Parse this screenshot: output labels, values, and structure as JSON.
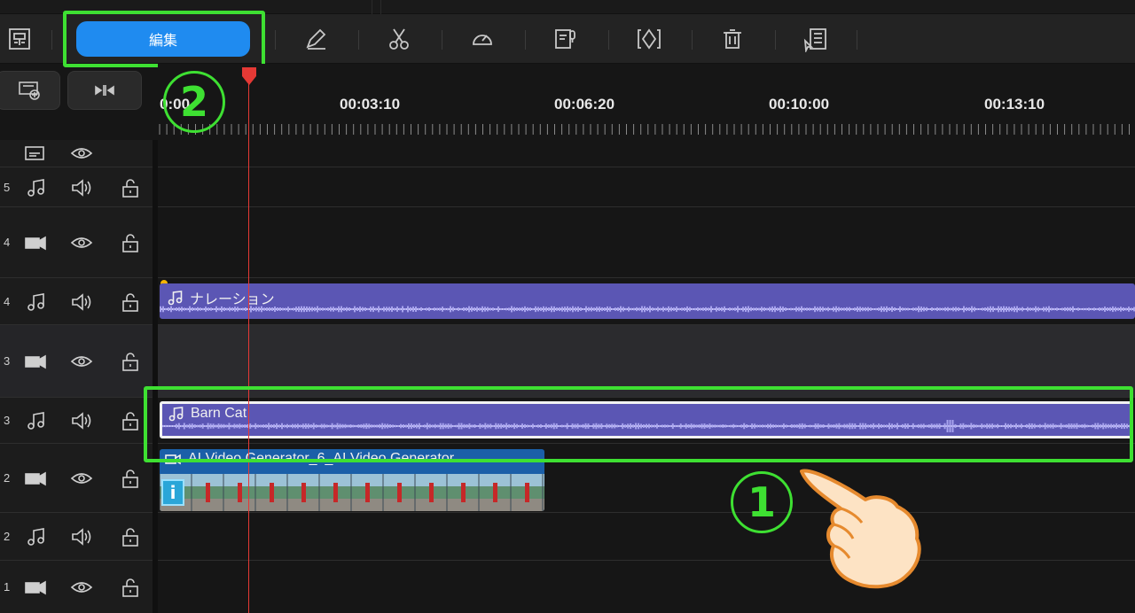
{
  "toolbar": {
    "edit_label": "編集",
    "icons": [
      "layout-icon",
      "pen-icon",
      "scissors-icon",
      "speed-icon",
      "voice-record-icon",
      "keyframe-icon",
      "trash-icon",
      "list-cursor-icon"
    ]
  },
  "ruler": {
    "start_label": "0:00",
    "labels": [
      "00:03:10",
      "00:06:20",
      "00:10:00",
      "00:13:10"
    ]
  },
  "tracks": [
    {
      "num": "5",
      "type": "audio"
    },
    {
      "num": "4",
      "type": "video"
    },
    {
      "num": "4",
      "type": "audio"
    },
    {
      "num": "3",
      "type": "video"
    },
    {
      "num": "3",
      "type": "audio"
    },
    {
      "num": "2",
      "type": "video"
    },
    {
      "num": "2",
      "type": "audio"
    },
    {
      "num": "1",
      "type": "video"
    }
  ],
  "clips": {
    "narration": "ナレーション",
    "barn_cat": "Barn Cat",
    "video": "AI Video Generator_6_AI Video Generator",
    "info_badge": "i"
  },
  "annotations": {
    "one": "1",
    "two": "2"
  },
  "colors": {
    "accent_blue": "#1f8bf0",
    "highlight_green": "#3ee032",
    "audio_clip": "#5b56b4",
    "video_clip": "#1b5fa8",
    "playhead": "#e53935"
  }
}
